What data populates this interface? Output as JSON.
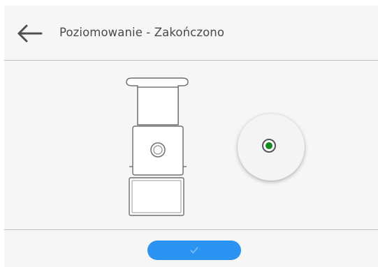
{
  "header": {
    "title": "Poziomowanie - Zakończono",
    "back_icon": "arrow-left-icon"
  },
  "main": {
    "scale_illustration_icon": "balance-scale-icon",
    "level_status": "level-ok",
    "level_indicator_color": "#138a1c"
  },
  "footer": {
    "confirm_icon": "checkmark-icon",
    "confirm_button_color": "#2b93f2"
  }
}
